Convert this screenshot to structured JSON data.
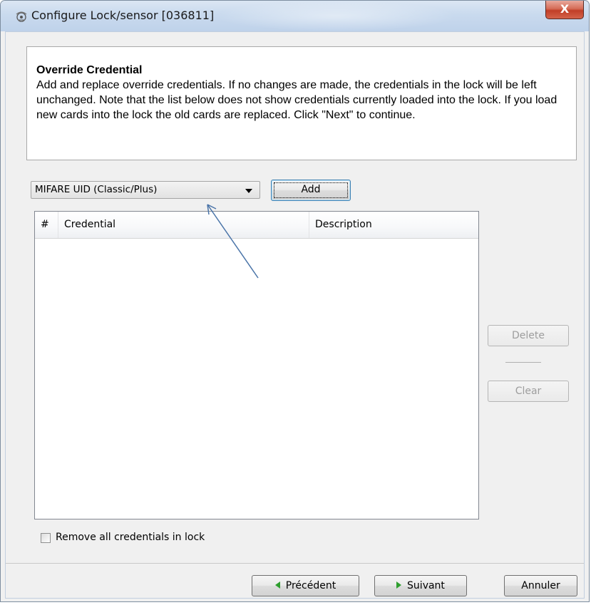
{
  "window": {
    "title": "Configure Lock/sensor [036811]",
    "close_label": "X"
  },
  "info": {
    "title": "Override Credential",
    "body": "Add and replace override credentials. If no changes are made, the credentials in the lock will be left unchanged. Note that the list below does not show credentials currently loaded into the lock. If you load new cards into the lock the old cards are replaced. Click \"Next\" to continue."
  },
  "credential_type": {
    "selected": "MIFARE UID (Classic/Plus)"
  },
  "buttons": {
    "add": "Add",
    "delete": "Delete",
    "clear": "Clear",
    "previous": "Précédent",
    "next": "Suivant",
    "cancel": "Annuler"
  },
  "table": {
    "columns": [
      "#",
      "Credential",
      "Description"
    ],
    "rows": []
  },
  "options": {
    "remove_all_label": "Remove all credentials in lock",
    "remove_all_checked": false
  },
  "colors": {
    "accent_arrow": "#4a74a8",
    "nav_arrow": "#2e9e2e",
    "close_button": "#c13f28"
  },
  "icons": {
    "title": "lock-sensor-icon",
    "previous": "arrow-left-icon",
    "next": "arrow-right-icon",
    "combo": "chevron-down-icon"
  }
}
